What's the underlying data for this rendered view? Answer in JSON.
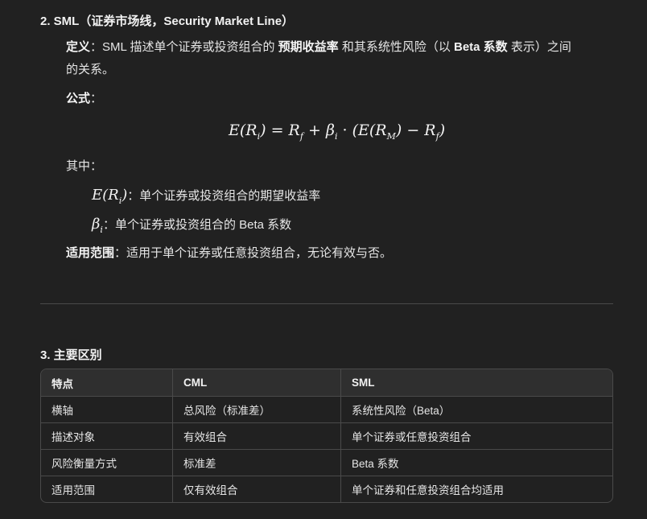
{
  "section2": {
    "heading": "2. SML（证券市场线，Security Market Line）",
    "definition_label": "定义",
    "definition_text_1": "：SML 描述单个证券或投资组合的 ",
    "definition_bold_1": "预期收益率",
    "definition_text_2": " 和其系统性风险（以 ",
    "definition_bold_2": "Beta 系数",
    "definition_text_3": " 表示）之间",
    "definition_text_4": "的关系。",
    "formula_label": "公式",
    "formula_colon": "：",
    "where_label": "其中：",
    "item1_text": "：单个证券或投资组合的期望收益率",
    "item2_text": "：单个证券或投资组合的 Beta 系数",
    "scope_label": "适用范围",
    "scope_text": "：适用于单个证券或任意投资组合，无论有效与否。"
  },
  "section3": {
    "heading": "3. 主要区别",
    "table": {
      "headers": [
        "特点",
        "CML",
        "SML"
      ],
      "rows": [
        [
          "横轴",
          "总风险（标准差）",
          "系统性风险（Beta）"
        ],
        [
          "描述对象",
          "有效组合",
          "单个证券或任意投资组合"
        ],
        [
          "风险衡量方式",
          "标准差",
          "Beta 系数"
        ],
        [
          "适用范围",
          "仅有效组合",
          "单个证券和任意投资组合均适用"
        ]
      ]
    }
  }
}
